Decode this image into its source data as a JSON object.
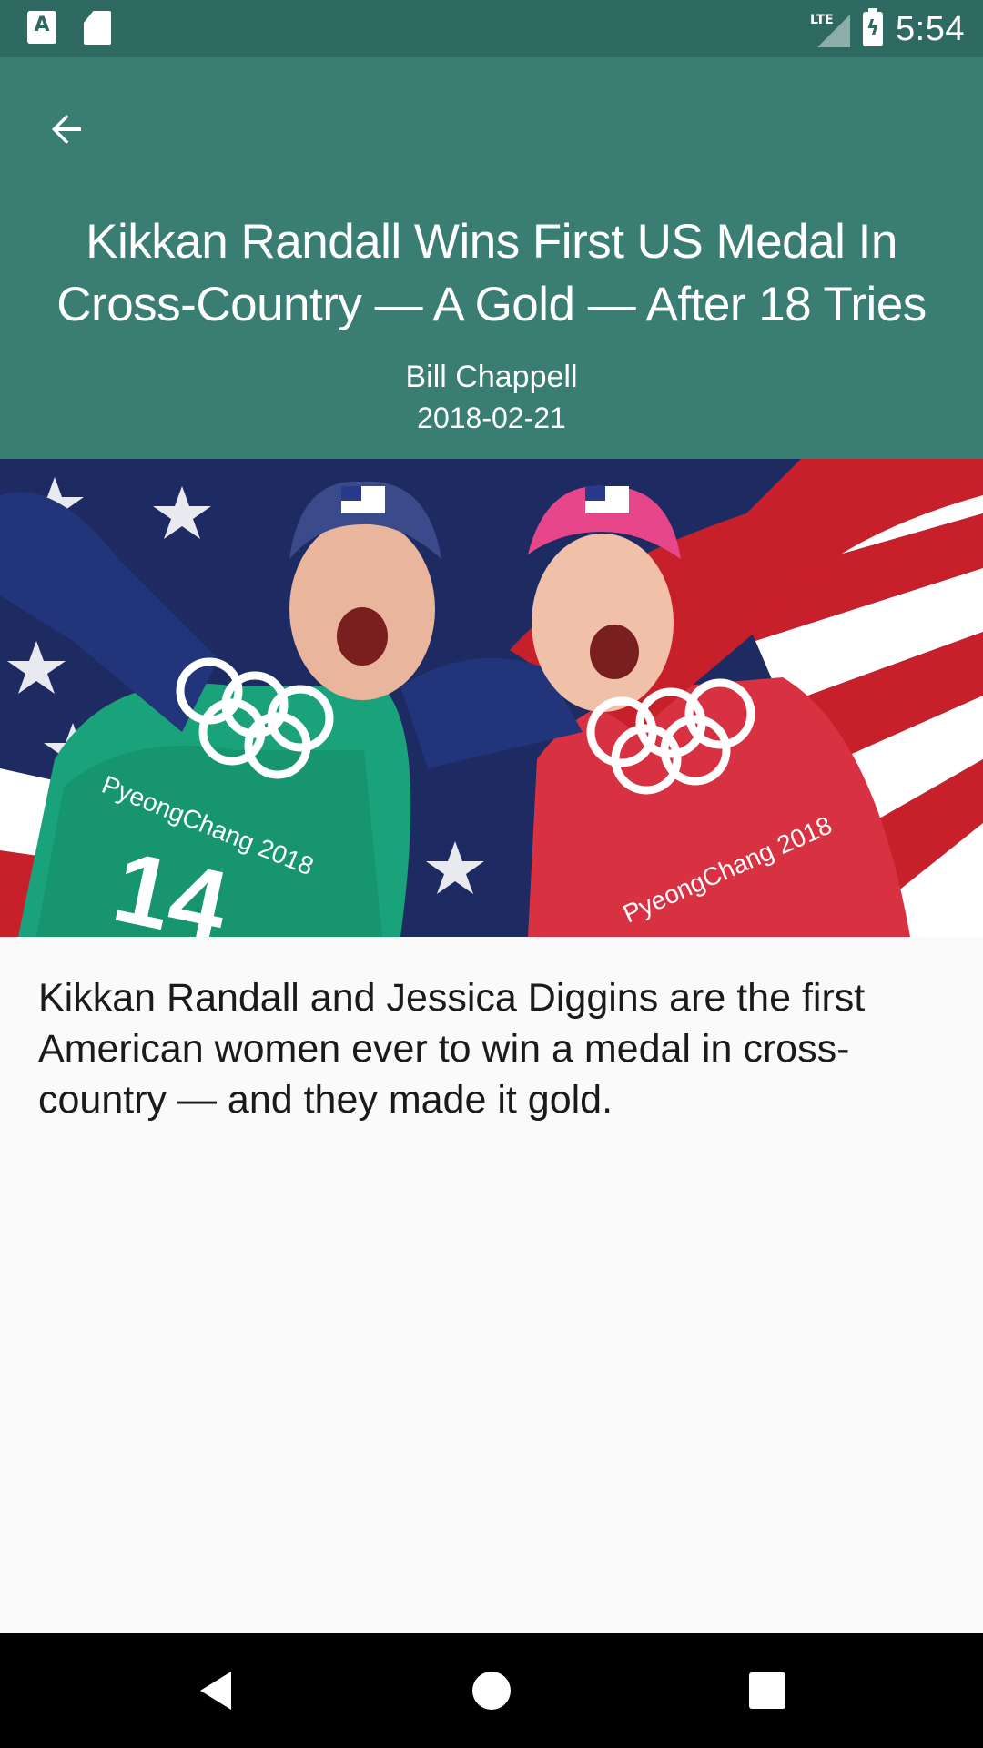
{
  "status_bar": {
    "time": "5:54",
    "network": "LTE",
    "notification_icons": [
      "a-icon",
      "sd-card-icon"
    ]
  },
  "header": {
    "back_icon": "arrow-back-icon",
    "title": "Kikkan Randall Wins First US Medal In Cross-Country — A Gold — After 18 Tries",
    "author": "Bill Chappell",
    "date": "2018-02-21",
    "background_color": "#3a7d72"
  },
  "hero_image": {
    "bib_left": "14",
    "text_left": "PyeongChang 2018",
    "text_right": "PyeongChang 2018"
  },
  "article": {
    "summary": "Kikkan Randall and Jessica Diggins are the first American women ever to win a medal in cross-country — and they made it gold."
  },
  "nav_bar": {
    "back_icon": "nav-back-icon",
    "home_icon": "nav-home-icon",
    "recents_icon": "nav-recents-icon"
  }
}
